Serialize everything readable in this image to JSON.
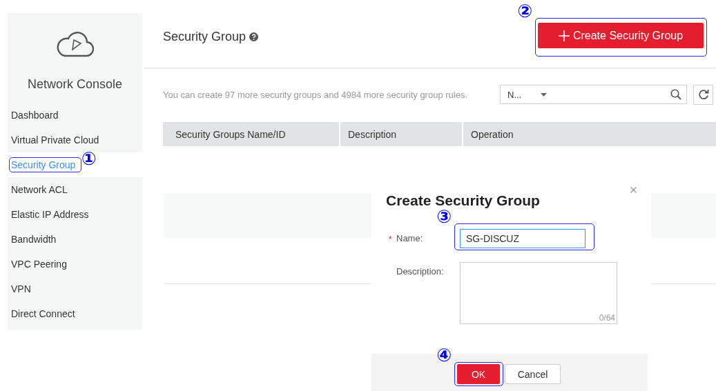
{
  "sidebar": {
    "title": "Network Console",
    "items": [
      {
        "label": "Dashboard",
        "selected": false
      },
      {
        "label": "Virtual Private Cloud",
        "selected": false
      },
      {
        "label": "Security Group",
        "selected": true,
        "callout": "①"
      },
      {
        "label": "Network ACL",
        "selected": false
      },
      {
        "label": "Elastic IP Address",
        "selected": false
      },
      {
        "label": "Bandwidth",
        "selected": false
      },
      {
        "label": "VPC Peering",
        "selected": false
      },
      {
        "label": "VPN",
        "selected": false
      },
      {
        "label": "Direct Connect",
        "selected": false
      }
    ]
  },
  "header": {
    "title": "Security Group",
    "create_button": {
      "label": "Create Security Group",
      "callout": "②"
    }
  },
  "toolbar": {
    "quota_text": "You can create 97 more security groups and 4984 more security group rules.",
    "filter": "N..."
  },
  "table": {
    "columns": [
      "Security Groups Name/ID",
      "Description",
      "Operation"
    ]
  },
  "dialog": {
    "title": "Create Security Group",
    "fields": [
      {
        "kind": "input",
        "label": "Name:",
        "required_mark": "*",
        "value": "SG-DISCUZ",
        "callout": "③"
      },
      {
        "kind": "textarea",
        "label": "Description:",
        "counter": "0/64"
      }
    ],
    "buttons": [
      {
        "label": "OK",
        "kind": "primary",
        "callout": "④"
      },
      {
        "label": "Cancel",
        "kind": "secondary"
      }
    ]
  }
}
